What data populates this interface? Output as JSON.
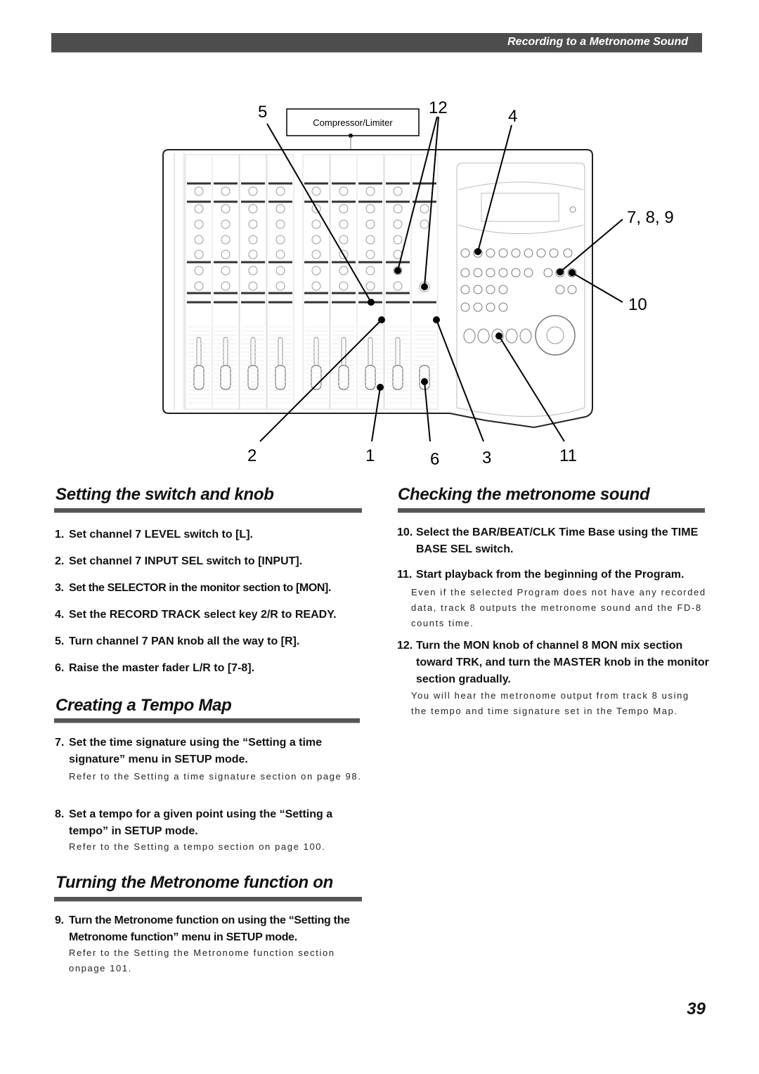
{
  "header": {
    "title": "Recording to a Metronome Sound"
  },
  "figure": {
    "box_label": "Compressor/Limiter",
    "callouts": {
      "c5": "5",
      "c12": "12",
      "c4": "4",
      "c789": "7, 8, 9",
      "c10": "10",
      "c2": "2",
      "c1": "1",
      "c6": "6",
      "c3": "3",
      "c11": "11"
    }
  },
  "sections": {
    "switch_knob": {
      "title": "Setting the switch and knob",
      "steps": [
        {
          "num": "1.",
          "text": "Set channel 7 LEVEL switch to [L]."
        },
        {
          "num": "2.",
          "text": "Set channel 7 INPUT SEL switch to [INPUT]."
        },
        {
          "num": "3.",
          "text": "Set the SELECTOR in the monitor section to [MON]."
        },
        {
          "num": "4.",
          "text": "Set the RECORD TRACK select key 2/R to READY."
        },
        {
          "num": "5.",
          "text": "Turn channel 7 PAN knob all the way to [R]."
        },
        {
          "num": "6.",
          "text": "Raise the master fader L/R to [7-8]."
        }
      ]
    },
    "tempo_map": {
      "title": "Creating a Tempo Map",
      "steps": [
        {
          "num": "7.",
          "text": "Set the time signature using the “Setting a time signature” menu in SETUP mode.",
          "note": "Refer to the  Setting a time signature  section on page 98."
        },
        {
          "num": "8.",
          "text": "Set a tempo for a given point using the “Setting a tempo” in SETUP mode.",
          "note": "Refer to the  Setting a tempo  section on page 100."
        }
      ]
    },
    "metronome_on": {
      "title": "Turning the Metronome function on",
      "steps": [
        {
          "num": "9.",
          "text": "Turn the Metronome function on using the “Setting the Metronome function” menu in SETUP mode.",
          "note": "Refer to the  Setting the Metronome function  section onpage 101."
        }
      ]
    },
    "checking": {
      "title": "Checking the metronome sound",
      "steps": [
        {
          "num": "10.",
          "text": "Select the BAR/BEAT/CLK Time Base using the TIME BASE SEL switch."
        },
        {
          "num": "11.",
          "text": "Start playback from the beginning of the Program.",
          "note": "Even if the selected Program does not have any recorded data, track 8 outputs the metronome sound and the FD-8 counts time."
        },
        {
          "num": "12.",
          "text": "Turn the MON knob of channel 8 MON mix section toward TRK, and turn the MASTER knob in the monitor section gradually.",
          "note": "You will hear the metronome output from track 8 using the tempo and time signature set in the Tempo Map."
        }
      ]
    }
  },
  "page_number": "39"
}
